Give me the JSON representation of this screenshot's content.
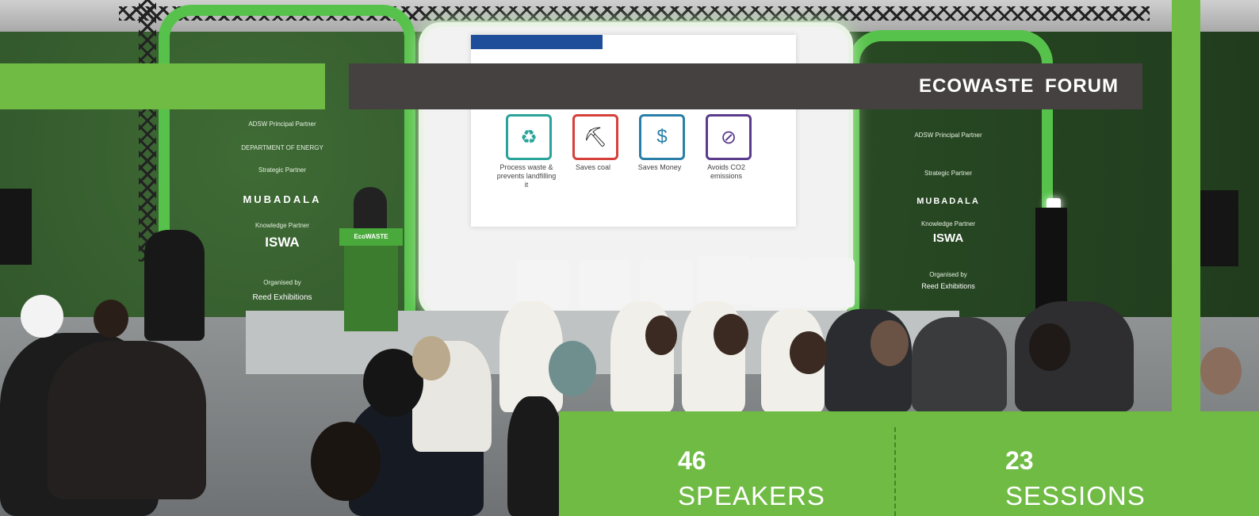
{
  "banner": {
    "title": "ECOWASTE FORUM"
  },
  "stats": [
    {
      "number": "46",
      "label": "SPEAKERS"
    },
    {
      "number": "23",
      "label": "SESSIONS"
    }
  ],
  "slide": {
    "items": [
      {
        "label": "Process waste & prevents landfilling it",
        "icon": "recycle-bin-icon",
        "color": "#2aa39a"
      },
      {
        "label": "Saves coal",
        "icon": "coal-cart-icon",
        "color": "#d6403a"
      },
      {
        "label": "Saves Money",
        "icon": "money-hand-icon",
        "color": "#2a7fa8"
      },
      {
        "label": "Avoids CO2 emissions",
        "icon": "no-co2-icon",
        "color": "#5a3b8c"
      }
    ]
  },
  "sponsors_left": {
    "principal_label": "ADSW Principal Partner",
    "principal_name": "DEPARTMENT OF ENERGY",
    "strategic_label": "Strategic Partner",
    "strategic_name": "MUBADALA",
    "knowledge_label": "Knowledge Partner",
    "knowledge_name": "ISWA",
    "organiser_label": "Organised by",
    "organiser_name": "Reed Exhibitions"
  },
  "sponsors_right": {
    "principal_label": "ADSW Principal Partner",
    "strategic_label": "Strategic Partner",
    "strategic_name": "MUBADALA",
    "knowledge_label": "Knowledge Partner",
    "knowledge_name": "ISWA",
    "organiser_label": "Organised by",
    "organiser_name": "Reed Exhibitions"
  },
  "podium_label": "EcoWASTE",
  "colors": {
    "accent_green": "#6fbb44",
    "title_bar": "#454141"
  }
}
